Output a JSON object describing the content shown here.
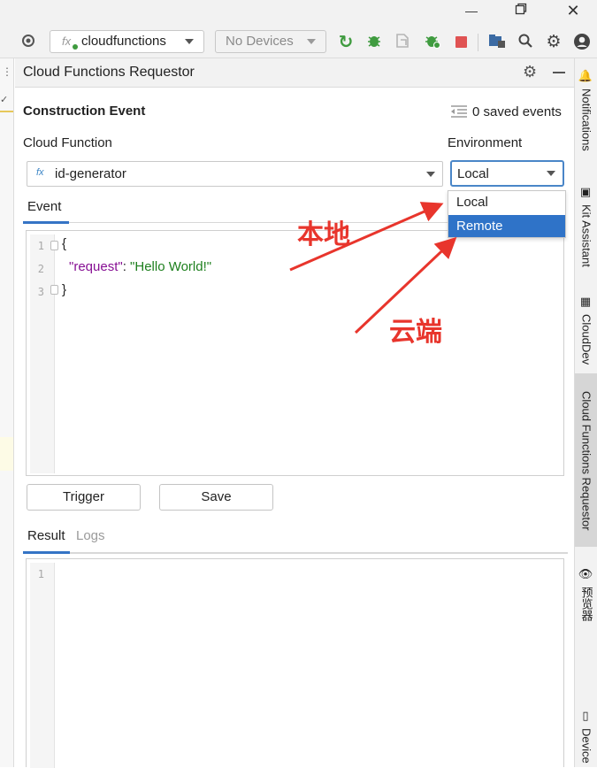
{
  "toolbar": {
    "run_config_icon_label": "fx",
    "run_config": "cloudfunctions",
    "device_selector": "No Devices",
    "accent_green": "#3f9b3f",
    "stop_red": "#e05353"
  },
  "panel": {
    "title": "Cloud Functions Requestor",
    "section_title": "Construction Event",
    "saved_events": "0 saved events",
    "cloud_function_label": "Cloud Function",
    "function_icon": "fx",
    "function_value": "id-generator",
    "environment_label": "Environment",
    "environment_value": "Local",
    "environment_options": [
      "Local",
      "Remote"
    ],
    "selected_option_color": "#2f73c8",
    "event_tab": "Event",
    "editor": {
      "line_numbers": [
        "1",
        "2",
        "3"
      ],
      "line1": "{",
      "key": "\"request\"",
      "colon": ": ",
      "value": "\"Hello World!\"",
      "line3": "}"
    },
    "trigger_button": "Trigger",
    "save_button": "Save",
    "result_tabs": [
      "Result",
      "Logs"
    ],
    "result_line_numbers": [
      "1"
    ]
  },
  "right_tool_windows": [
    "Notifications",
    "Kit Assistant",
    "CloudDev",
    "Cloud Functions Requestor",
    "预览器",
    "Device"
  ],
  "annotations": {
    "local_text": "本地",
    "remote_text": "云端",
    "color": "#e8352c"
  }
}
